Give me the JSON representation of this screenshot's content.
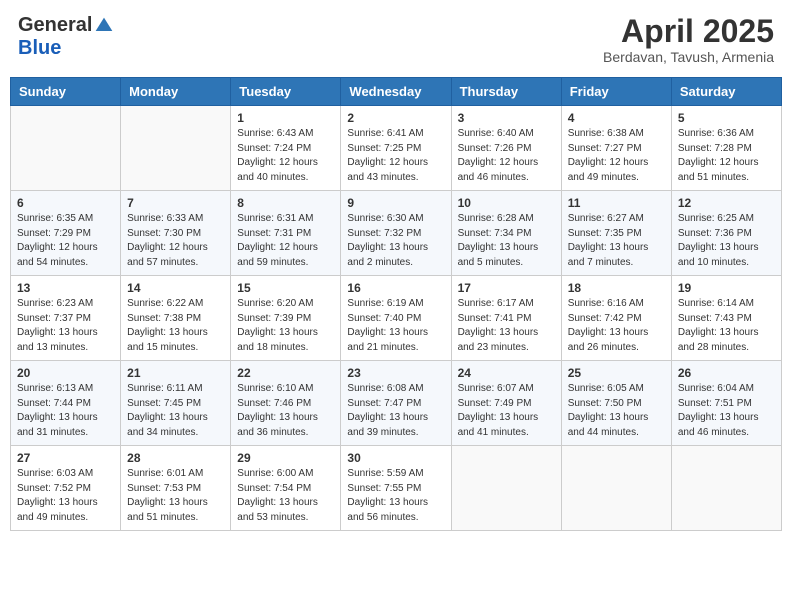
{
  "header": {
    "logo_general": "General",
    "logo_blue": "Blue",
    "month_title": "April 2025",
    "location": "Berdavan, Tavush, Armenia"
  },
  "days_of_week": [
    "Sunday",
    "Monday",
    "Tuesday",
    "Wednesday",
    "Thursday",
    "Friday",
    "Saturday"
  ],
  "weeks": [
    [
      {
        "day": "",
        "sunrise": "",
        "sunset": "",
        "daylight": ""
      },
      {
        "day": "",
        "sunrise": "",
        "sunset": "",
        "daylight": ""
      },
      {
        "day": "1",
        "sunrise": "Sunrise: 6:43 AM",
        "sunset": "Sunset: 7:24 PM",
        "daylight": "Daylight: 12 hours and 40 minutes."
      },
      {
        "day": "2",
        "sunrise": "Sunrise: 6:41 AM",
        "sunset": "Sunset: 7:25 PM",
        "daylight": "Daylight: 12 hours and 43 minutes."
      },
      {
        "day": "3",
        "sunrise": "Sunrise: 6:40 AM",
        "sunset": "Sunset: 7:26 PM",
        "daylight": "Daylight: 12 hours and 46 minutes."
      },
      {
        "day": "4",
        "sunrise": "Sunrise: 6:38 AM",
        "sunset": "Sunset: 7:27 PM",
        "daylight": "Daylight: 12 hours and 49 minutes."
      },
      {
        "day": "5",
        "sunrise": "Sunrise: 6:36 AM",
        "sunset": "Sunset: 7:28 PM",
        "daylight": "Daylight: 12 hours and 51 minutes."
      }
    ],
    [
      {
        "day": "6",
        "sunrise": "Sunrise: 6:35 AM",
        "sunset": "Sunset: 7:29 PM",
        "daylight": "Daylight: 12 hours and 54 minutes."
      },
      {
        "day": "7",
        "sunrise": "Sunrise: 6:33 AM",
        "sunset": "Sunset: 7:30 PM",
        "daylight": "Daylight: 12 hours and 57 minutes."
      },
      {
        "day": "8",
        "sunrise": "Sunrise: 6:31 AM",
        "sunset": "Sunset: 7:31 PM",
        "daylight": "Daylight: 12 hours and 59 minutes."
      },
      {
        "day": "9",
        "sunrise": "Sunrise: 6:30 AM",
        "sunset": "Sunset: 7:32 PM",
        "daylight": "Daylight: 13 hours and 2 minutes."
      },
      {
        "day": "10",
        "sunrise": "Sunrise: 6:28 AM",
        "sunset": "Sunset: 7:34 PM",
        "daylight": "Daylight: 13 hours and 5 minutes."
      },
      {
        "day": "11",
        "sunrise": "Sunrise: 6:27 AM",
        "sunset": "Sunset: 7:35 PM",
        "daylight": "Daylight: 13 hours and 7 minutes."
      },
      {
        "day": "12",
        "sunrise": "Sunrise: 6:25 AM",
        "sunset": "Sunset: 7:36 PM",
        "daylight": "Daylight: 13 hours and 10 minutes."
      }
    ],
    [
      {
        "day": "13",
        "sunrise": "Sunrise: 6:23 AM",
        "sunset": "Sunset: 7:37 PM",
        "daylight": "Daylight: 13 hours and 13 minutes."
      },
      {
        "day": "14",
        "sunrise": "Sunrise: 6:22 AM",
        "sunset": "Sunset: 7:38 PM",
        "daylight": "Daylight: 13 hours and 15 minutes."
      },
      {
        "day": "15",
        "sunrise": "Sunrise: 6:20 AM",
        "sunset": "Sunset: 7:39 PM",
        "daylight": "Daylight: 13 hours and 18 minutes."
      },
      {
        "day": "16",
        "sunrise": "Sunrise: 6:19 AM",
        "sunset": "Sunset: 7:40 PM",
        "daylight": "Daylight: 13 hours and 21 minutes."
      },
      {
        "day": "17",
        "sunrise": "Sunrise: 6:17 AM",
        "sunset": "Sunset: 7:41 PM",
        "daylight": "Daylight: 13 hours and 23 minutes."
      },
      {
        "day": "18",
        "sunrise": "Sunrise: 6:16 AM",
        "sunset": "Sunset: 7:42 PM",
        "daylight": "Daylight: 13 hours and 26 minutes."
      },
      {
        "day": "19",
        "sunrise": "Sunrise: 6:14 AM",
        "sunset": "Sunset: 7:43 PM",
        "daylight": "Daylight: 13 hours and 28 minutes."
      }
    ],
    [
      {
        "day": "20",
        "sunrise": "Sunrise: 6:13 AM",
        "sunset": "Sunset: 7:44 PM",
        "daylight": "Daylight: 13 hours and 31 minutes."
      },
      {
        "day": "21",
        "sunrise": "Sunrise: 6:11 AM",
        "sunset": "Sunset: 7:45 PM",
        "daylight": "Daylight: 13 hours and 34 minutes."
      },
      {
        "day": "22",
        "sunrise": "Sunrise: 6:10 AM",
        "sunset": "Sunset: 7:46 PM",
        "daylight": "Daylight: 13 hours and 36 minutes."
      },
      {
        "day": "23",
        "sunrise": "Sunrise: 6:08 AM",
        "sunset": "Sunset: 7:47 PM",
        "daylight": "Daylight: 13 hours and 39 minutes."
      },
      {
        "day": "24",
        "sunrise": "Sunrise: 6:07 AM",
        "sunset": "Sunset: 7:49 PM",
        "daylight": "Daylight: 13 hours and 41 minutes."
      },
      {
        "day": "25",
        "sunrise": "Sunrise: 6:05 AM",
        "sunset": "Sunset: 7:50 PM",
        "daylight": "Daylight: 13 hours and 44 minutes."
      },
      {
        "day": "26",
        "sunrise": "Sunrise: 6:04 AM",
        "sunset": "Sunset: 7:51 PM",
        "daylight": "Daylight: 13 hours and 46 minutes."
      }
    ],
    [
      {
        "day": "27",
        "sunrise": "Sunrise: 6:03 AM",
        "sunset": "Sunset: 7:52 PM",
        "daylight": "Daylight: 13 hours and 49 minutes."
      },
      {
        "day": "28",
        "sunrise": "Sunrise: 6:01 AM",
        "sunset": "Sunset: 7:53 PM",
        "daylight": "Daylight: 13 hours and 51 minutes."
      },
      {
        "day": "29",
        "sunrise": "Sunrise: 6:00 AM",
        "sunset": "Sunset: 7:54 PM",
        "daylight": "Daylight: 13 hours and 53 minutes."
      },
      {
        "day": "30",
        "sunrise": "Sunrise: 5:59 AM",
        "sunset": "Sunset: 7:55 PM",
        "daylight": "Daylight: 13 hours and 56 minutes."
      },
      {
        "day": "",
        "sunrise": "",
        "sunset": "",
        "daylight": ""
      },
      {
        "day": "",
        "sunrise": "",
        "sunset": "",
        "daylight": ""
      },
      {
        "day": "",
        "sunrise": "",
        "sunset": "",
        "daylight": ""
      }
    ]
  ]
}
